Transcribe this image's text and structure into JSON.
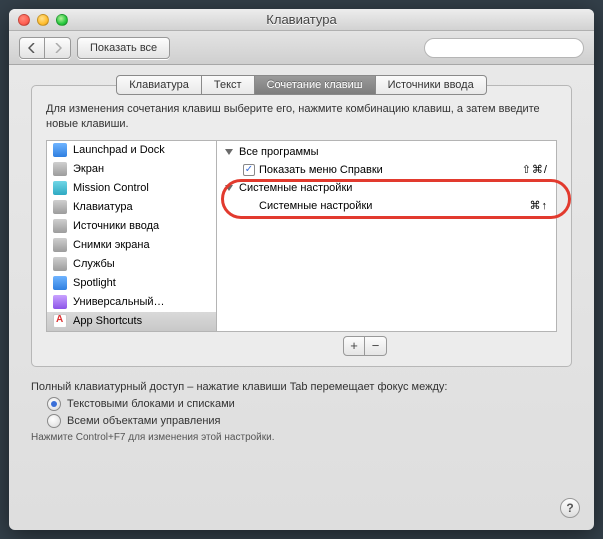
{
  "window": {
    "title": "Клавиатура"
  },
  "toolbar": {
    "show_all": "Показать все",
    "search_placeholder": ""
  },
  "tabs": {
    "0": "Клавиатура",
    "1": "Текст",
    "2": "Сочетание клавиш",
    "3": "Источники ввода",
    "active_index": 2
  },
  "description": "Для изменения сочетания клавиш выберите его, нажмите комбинацию клавиш, а затем введите новые клавиши.",
  "sidebar": {
    "items": [
      {
        "label": "Launchpad и Dock",
        "icon": "blue"
      },
      {
        "label": "Экран",
        "icon": "gray"
      },
      {
        "label": "Mission Control",
        "icon": "teal"
      },
      {
        "label": "Клавиатура",
        "icon": "gray"
      },
      {
        "label": "Источники ввода",
        "icon": "gray"
      },
      {
        "label": "Снимки экрана",
        "icon": "gray"
      },
      {
        "label": "Службы",
        "icon": "gray"
      },
      {
        "label": "Spotlight",
        "icon": "blue"
      },
      {
        "label": "Универсальный…",
        "icon": "purple"
      },
      {
        "label": "App Shortcuts",
        "icon": "app",
        "selected": true
      }
    ]
  },
  "shortcuts": {
    "group0_label": "Все программы",
    "row0_label": "Показать меню Справки",
    "row0_shortcut": "⇧⌘/",
    "group1_label": "Системные настройки",
    "row1_label": "Системные настройки",
    "row1_shortcut": "⌘↑"
  },
  "buttons": {
    "add": "+",
    "remove": "−"
  },
  "footer": {
    "heading": "Полный клавиатурный доступ – нажатие клавиши Tab перемещает фокус между:",
    "radio0": "Текстовыми блоками и списками",
    "radio1": "Всеми объектами управления",
    "hint": "Нажмите Control+F7 для изменения этой настройки."
  },
  "help": "?"
}
